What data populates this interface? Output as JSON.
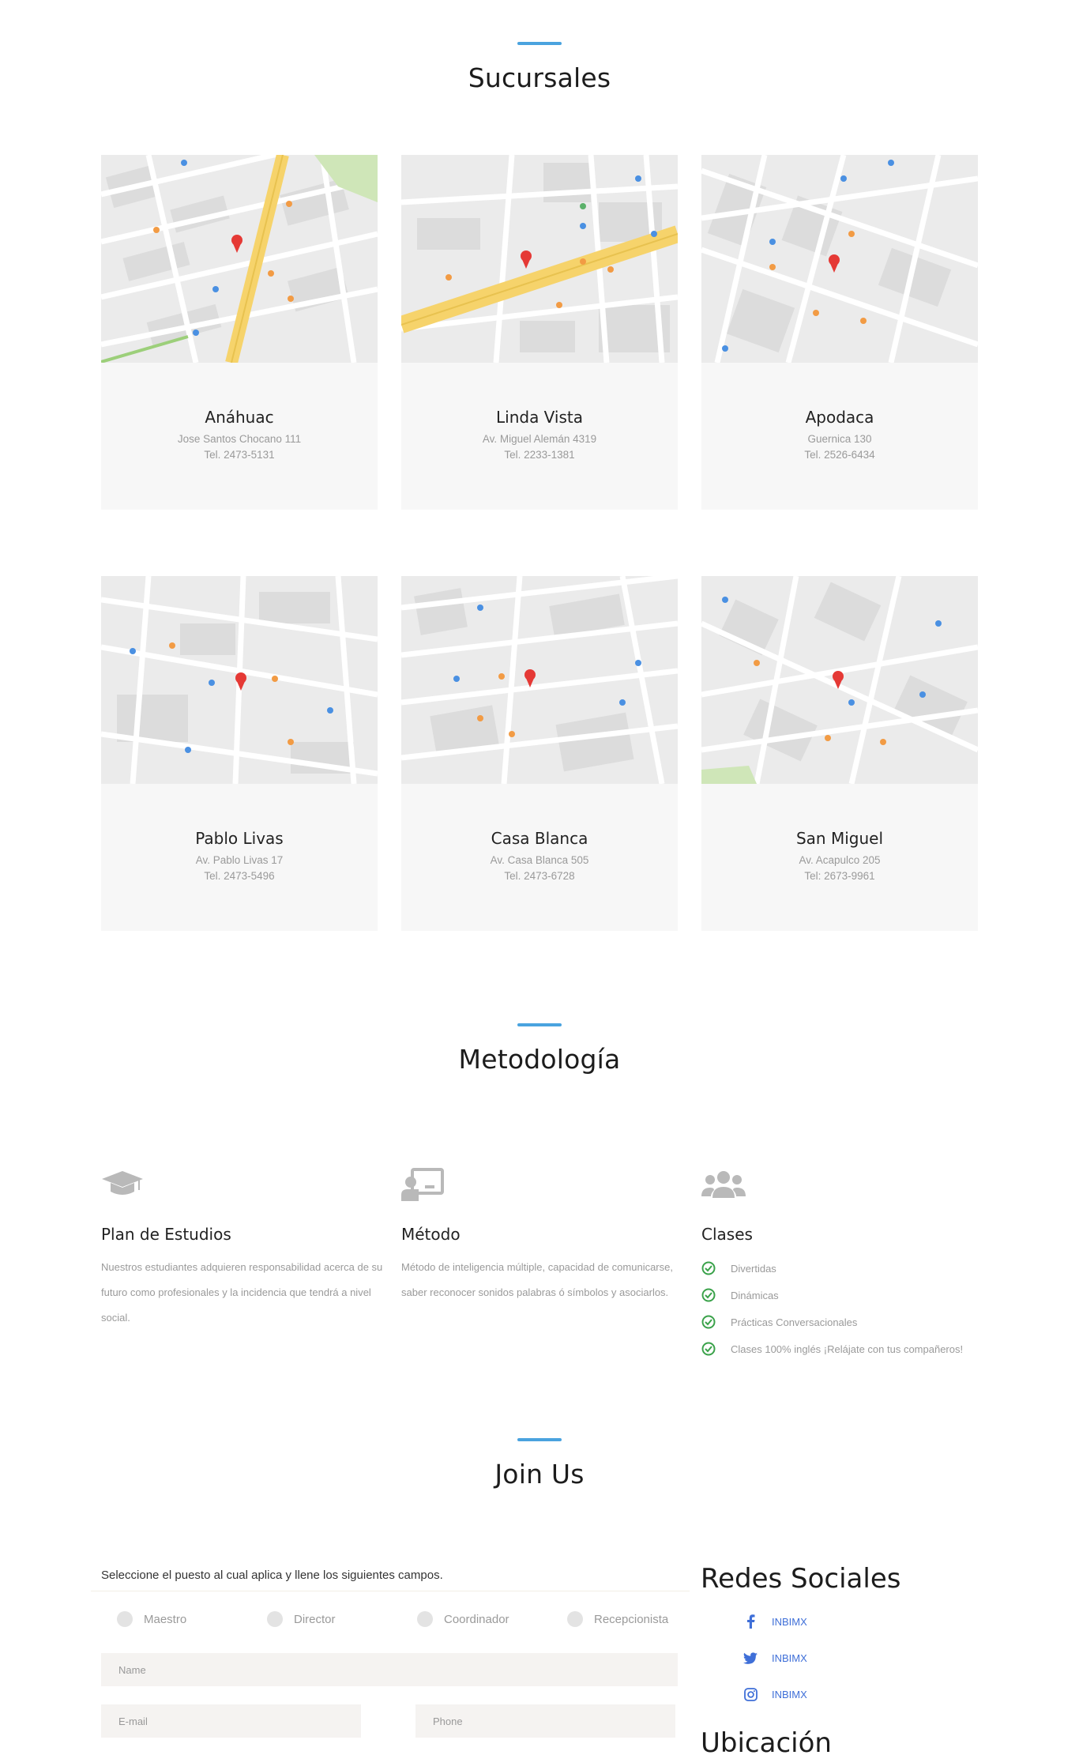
{
  "sucursales": {
    "title": "Sucursales",
    "branches": [
      {
        "name": "Anáhuac",
        "address": "Jose Santos Chocano 111",
        "phone": "Tel. 2473-5131"
      },
      {
        "name": "Linda Vista",
        "address": "Av. Miguel Alemán 4319",
        "phone": "Tel. 2233-1381"
      },
      {
        "name": "Apodaca",
        "address": "Guernica 130",
        "phone": "Tel. 2526-6434"
      },
      {
        "name": "Pablo Livas",
        "address": "Av. Pablo Livas 17",
        "phone": "Tel. 2473-5496"
      },
      {
        "name": "Casa Blanca",
        "address": "Av. Casa Blanca 505",
        "phone": "Tel. 2473-6728"
      },
      {
        "name": "San Miguel",
        "address": "Av. Acapulco 205",
        "phone": "Tel: 2673-9961"
      }
    ]
  },
  "metodologia": {
    "title": "Metodología",
    "items": [
      {
        "icon": "graduation-cap-icon",
        "title": "Plan de Estudios",
        "text": "Nuestros estudiantes adquieren responsabilidad acerca de su futuro como profesionales y la incidencia que tendrá a nivel social."
      },
      {
        "icon": "chalkboard-teacher-icon",
        "title": "Método",
        "text": "Método de inteligencia múltiple, capacidad de comunicarse, saber reconocer sonidos palabras ó símbolos y asociarlos."
      },
      {
        "icon": "users-icon",
        "title": "Clases",
        "checklist": [
          "Divertidas",
          "Dinámicas",
          "Prácticas Conversacionales",
          "Clases 100% inglés ¡Relájate con tus compañeros!"
        ]
      }
    ]
  },
  "join": {
    "title": "Join Us",
    "intro": "Seleccione el puesto al cual aplica y llene los siguientes campos.",
    "positions": [
      "Maestro",
      "Director",
      "Coordinador",
      "Recepcionista"
    ],
    "fields": {
      "name": "Name",
      "email": "E-mail",
      "phone": "Phone"
    }
  },
  "social": {
    "title": "Redes Sociales",
    "items": [
      {
        "icon": "facebook-icon",
        "label": "INBIMX"
      },
      {
        "icon": "twitter-icon",
        "label": "INBIMX"
      },
      {
        "icon": "instagram-icon",
        "label": "INBIMX"
      }
    ]
  },
  "ubicacion": {
    "title": "Ubicación"
  },
  "colors": {
    "accent": "#4aa3df",
    "check": "#3aa24a",
    "social": "#3f6fd8",
    "map_road": "#f6d36b",
    "map_pin": "#e53935"
  }
}
